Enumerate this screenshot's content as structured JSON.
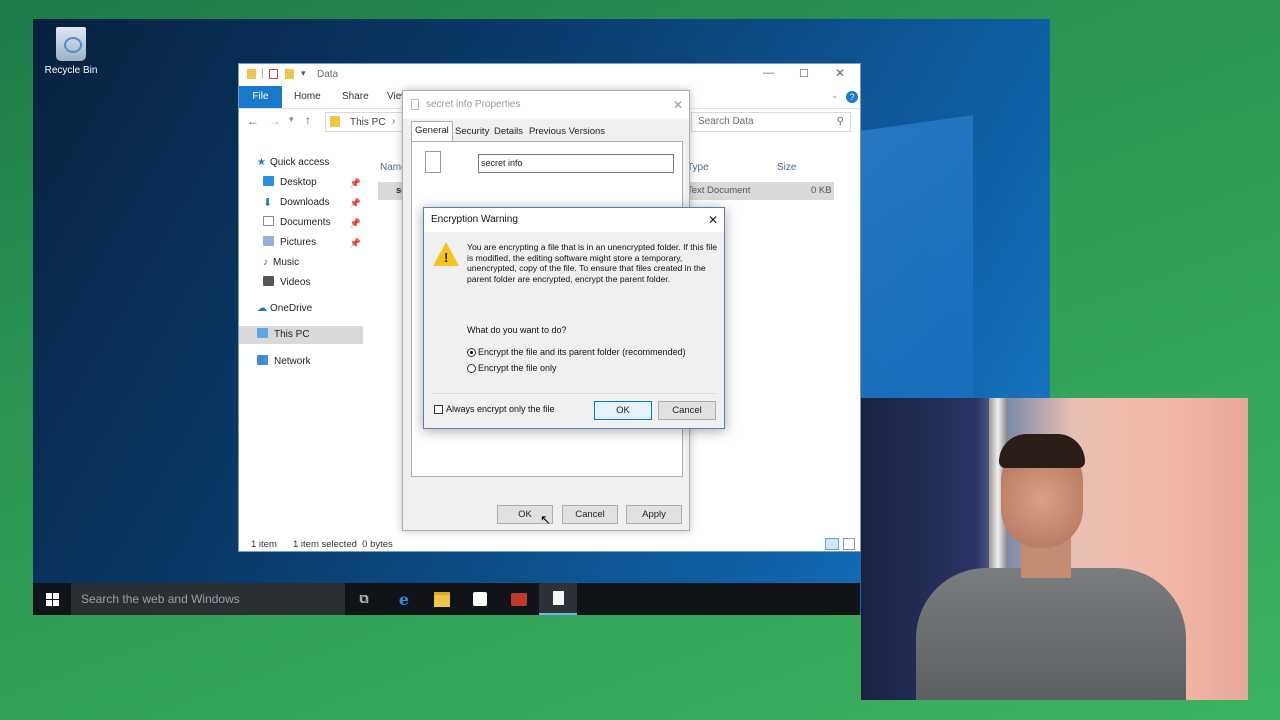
{
  "desktop": {
    "recycle_bin_label": "Recycle Bin"
  },
  "taskbar": {
    "search_placeholder": "Search the web and Windows",
    "apps": [
      "task-view-icon",
      "edge-icon",
      "file-explorer-icon",
      "store-icon",
      "media-app-icon",
      "notepad-icon"
    ]
  },
  "explorer": {
    "title": "Data",
    "ribbon_tabs": [
      "File",
      "Home",
      "Share",
      "View"
    ],
    "address": {
      "path_segment": "This PC",
      "search_placeholder": "Search Data"
    },
    "nav": {
      "quick_access": "Quick access",
      "items": [
        "Desktop",
        "Downloads",
        "Documents",
        "Pictures",
        "Music",
        "Videos"
      ],
      "onedrive": "OneDrive",
      "this_pc": "This PC",
      "network": "Network"
    },
    "columns": {
      "name": "Name",
      "type": "Type",
      "size": "Size"
    },
    "file": {
      "name": "se",
      "type": "Text Document",
      "size": "0 KB"
    },
    "status": {
      "count": "1 item",
      "selected": "1 item selected  0 bytes"
    }
  },
  "properties": {
    "title": "secret info Properties",
    "tabs": [
      "General",
      "Security",
      "Details",
      "Previous Versions"
    ],
    "file_name": "secret info",
    "ok_label": "OK",
    "cancel_label": "Cancel",
    "apply_label": "Apply"
  },
  "warning": {
    "title": "Encryption Warning",
    "message": "You are encrypting a file that is in an unencrypted folder. If this file is modified, the editing software might store a temporary, unencrypted, copy of the file. To ensure that files created in the parent folder are encrypted, encrypt the parent folder.",
    "question": "What do you want to do?",
    "option_parent": "Encrypt the file and its parent folder (recommended)",
    "option_file": "Encrypt the file only",
    "always_checkbox": "Always encrypt only the file",
    "ok_label": "OK",
    "cancel_label": "Cancel"
  },
  "colors": {
    "accent": "#1979ca",
    "taskbar": "#101418",
    "desktop": "#0a3d6e"
  }
}
